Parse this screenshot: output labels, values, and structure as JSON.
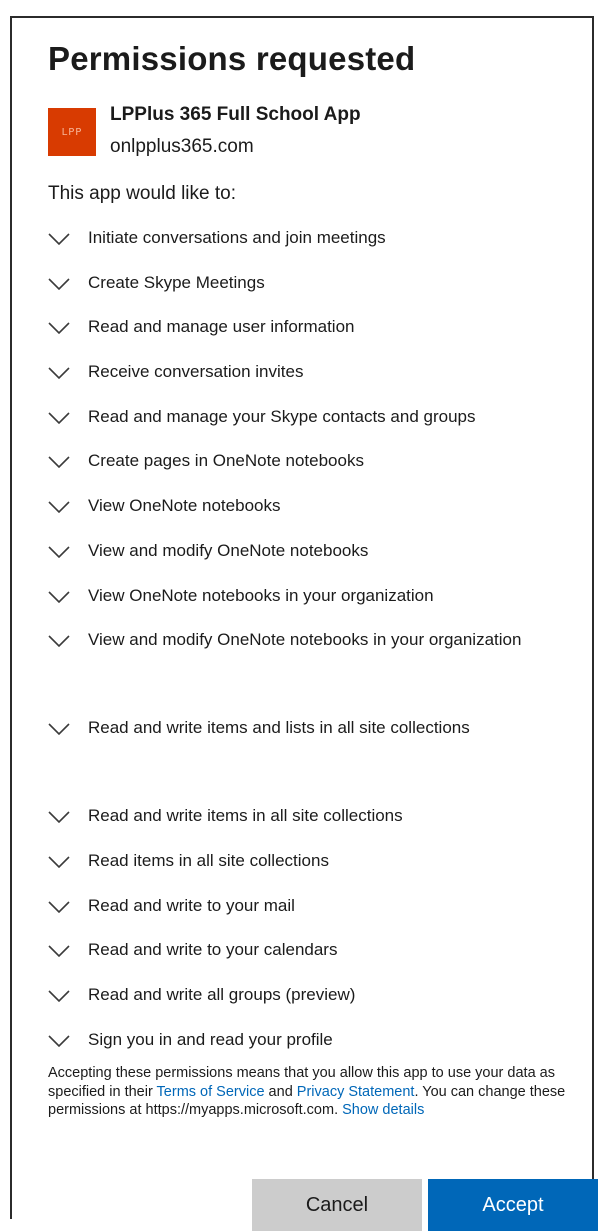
{
  "dialog": {
    "title": "Permissions requested"
  },
  "app": {
    "name": "LPPlus 365 Full School App",
    "domain": "onlpplus365.com",
    "logo_color": "#d83b01",
    "logo_text": "LPP"
  },
  "intro": "This app would like to:",
  "permissions": [
    {
      "label": "Initiate conversations and join meetings",
      "icon": "chevron-down-icon"
    },
    {
      "label": "Create Skype Meetings",
      "icon": "chevron-down-icon"
    },
    {
      "label": "Read and manage user information",
      "icon": "chevron-down-icon"
    },
    {
      "label": "Receive conversation invites",
      "icon": "chevron-down-icon"
    },
    {
      "label": "Read and manage your Skype contacts and groups",
      "icon": "chevron-down-icon"
    },
    {
      "label": "Create pages in OneNote notebooks",
      "icon": "chevron-down-icon"
    },
    {
      "label": "View OneNote notebooks",
      "icon": "chevron-down-icon"
    },
    {
      "label": "View and modify OneNote notebooks",
      "icon": "chevron-down-icon"
    },
    {
      "label": "View OneNote notebooks in your organization",
      "icon": "chevron-down-icon"
    },
    {
      "label": "View and modify OneNote notebooks in your organization",
      "icon": "chevron-down-icon"
    },
    {
      "label": "Read and write items and lists in all site collections",
      "icon": "chevron-down-icon"
    },
    {
      "label": "Read and write items in all site collections",
      "icon": "chevron-down-icon"
    },
    {
      "label": "Read items in all site collections",
      "icon": "chevron-down-icon"
    },
    {
      "label": "Read and write to your mail",
      "icon": "chevron-down-icon"
    },
    {
      "label": "Read and write to your calendars",
      "icon": "chevron-down-icon"
    },
    {
      "label": "Read and write all groups (preview)",
      "icon": "chevron-down-icon"
    },
    {
      "label": "Sign you in and read your profile",
      "icon": "chevron-down-icon"
    }
  ],
  "legal": {
    "text_1": "Accepting these permissions means that you allow this app to use your data as specified in their ",
    "terms_link": "Terms of Service",
    "text_2": " and ",
    "privacy_link": "Privacy Statement",
    "text_3": ". You can change these permissions at https://myapps.microsoft.com. ",
    "details_link": "Show details",
    "link_color": "#0067b8"
  },
  "buttons": {
    "cancel_label": "Cancel",
    "accept_label": "Accept",
    "accept_color": "#0067b8",
    "cancel_color": "#cccccc"
  }
}
